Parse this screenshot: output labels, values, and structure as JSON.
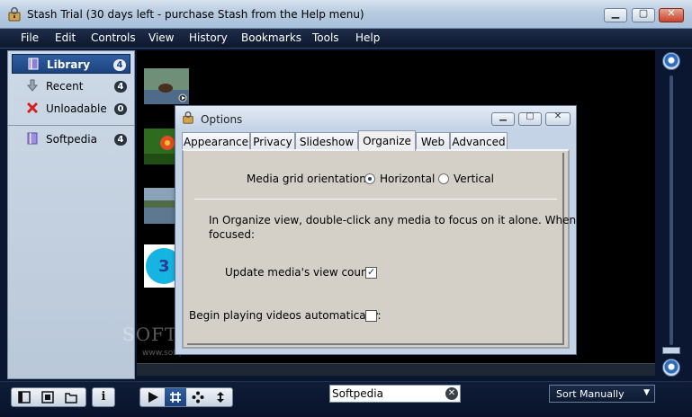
{
  "window": {
    "title": "Stash Trial (30 days left - purchase Stash from the Help menu)",
    "minimize": "▁",
    "maximize": "▢",
    "close": "✕"
  },
  "menu": [
    "File",
    "Edit",
    "Controls",
    "View",
    "History",
    "Bookmarks",
    "Tools",
    "Help"
  ],
  "sidebar": {
    "items": [
      {
        "label": "Library",
        "count": "4",
        "icon": "library-icon",
        "selected": true
      },
      {
        "label": "Recent",
        "count": "4",
        "icon": "down-arrow-icon"
      },
      {
        "label": "Unloadable",
        "count": "0",
        "icon": "red-x-icon"
      },
      {
        "label": "Softpedia",
        "count": "4",
        "icon": "book-icon"
      }
    ]
  },
  "watermark": {
    "text": "SOFTPEDIA",
    "url": "www.softpedia.com"
  },
  "bottombar": {
    "info_label": "i",
    "search_value": "Softpedia",
    "sort_value": "Sort Manually",
    "sort_arrow": "▼"
  },
  "dialog": {
    "title": "Options",
    "tabs": [
      "Appearance",
      "Privacy",
      "Slideshow",
      "Organize",
      "Web",
      "Advanced"
    ],
    "active_tab": "Organize",
    "orientation_label": "Media grid orientation:",
    "horizontal_label": "Horizontal",
    "vertical_label": "Vertical",
    "help_text_line1": "In Organize view, double-click any media to focus on it alone. When",
    "help_text_line2": "focused:",
    "view_count_label": "Update media's view count:",
    "autoplay_label": "Begin playing videos automatically:"
  },
  "colors": {
    "accent": "#1d4380",
    "menubar": "#0c172c",
    "dialog": "#c4d3e6"
  }
}
